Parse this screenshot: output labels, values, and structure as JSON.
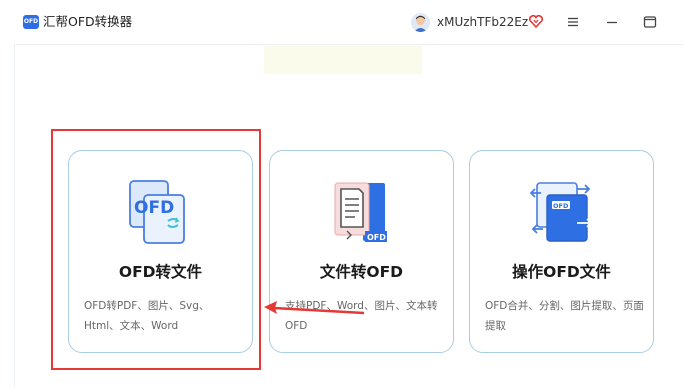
{
  "app": {
    "logo_text": "OFD",
    "title": "汇帮OFD转换器"
  },
  "header": {
    "username": "xMUzhTFb22Ez",
    "vip_icon": "heart-diamond-icon",
    "window_buttons": [
      "menu-icon",
      "minimize-icon",
      "maximize-icon"
    ]
  },
  "cards": [
    {
      "icon": "ofd-document-icon",
      "title": "OFD转文件",
      "description": "OFD转PDF、图片、Svg、Html、文本、Word"
    },
    {
      "icon": "document-to-ofd-icon",
      "title": "文件转OFD",
      "description": "支持PDF、Word、图片、文本转OFD"
    },
    {
      "icon": "ofd-operations-icon",
      "title": "操作OFD文件",
      "description": "OFD合并、分割、图片提取、页面提取"
    }
  ],
  "colors": {
    "accent": "#2f6fe4",
    "card_border": "#a8cde4",
    "highlight": "#e53935"
  }
}
